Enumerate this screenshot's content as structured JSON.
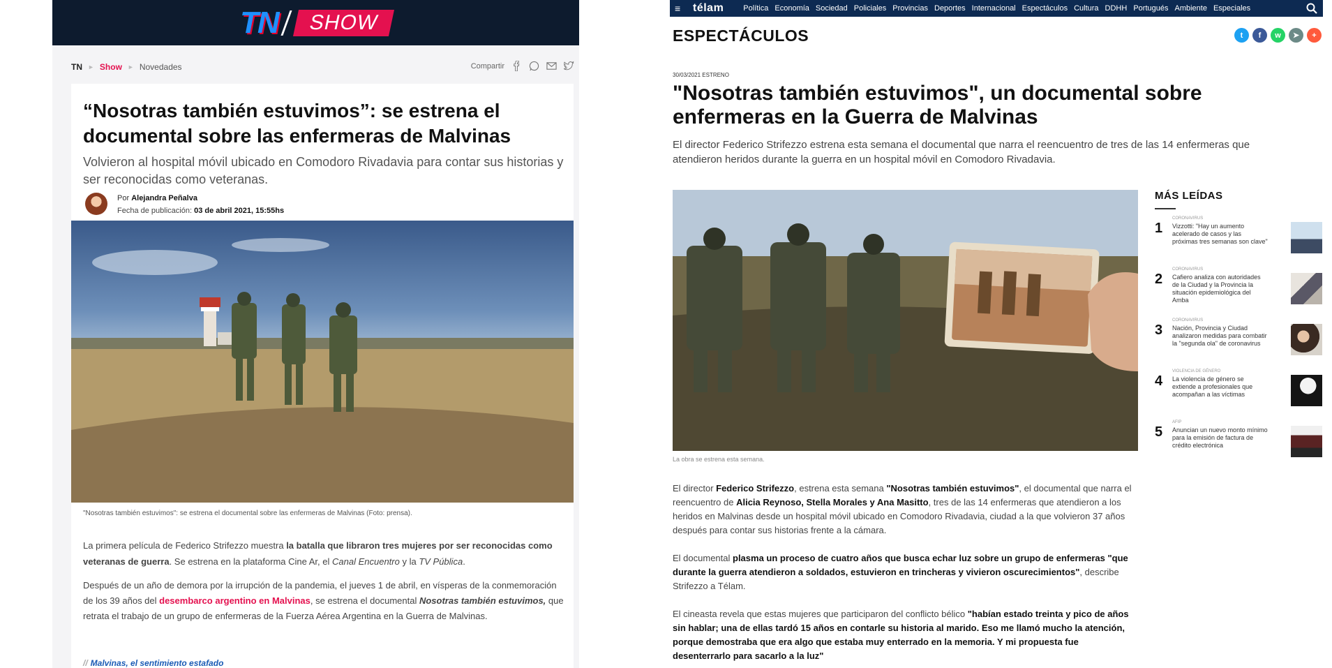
{
  "tn": {
    "logo": "TN",
    "show": "SHOW",
    "breadcrumb": {
      "home": "TN",
      "section": "Show",
      "current": "Novedades"
    },
    "share_label": "Compartir",
    "title": "“Nosotras también estuvimos”: se estrena el documental sobre las enfermeras de Malvinas",
    "subtitle": "Volvieron al hospital móvil ubicado en Comodoro Rivadavia para contar sus historias y ser reconocidas como veteranas.",
    "author_prefix": "Por",
    "author": "Alejandra Peñalva",
    "date_label": "Fecha de publicación:",
    "date": "03 de abril 2021, 15:55hs",
    "caption": "\"Nosotras también estuvimos\": se estrena el documental sobre las enfermeras de Malvinas (Foto: prensa).",
    "p1": {
      "a": "La primera película de Federico Strifezzo muestra ",
      "b": "la batalla que libraron tres mujeres por ser reconocidas como veteranas de guerra",
      "c": ". Se estrena en la plataforma Cine Ar, el ",
      "d": "Canal Encuentro",
      "e": " y la ",
      "f": "TV Pública",
      "g": "."
    },
    "p2": {
      "a": "Después de un año de demora por la irrupción de la pandemia, el jueves 1 de abril, en vísperas de la conmemoración de los 39 años del ",
      "link": "desembarco argentino en Malvinas",
      "b": ", se estrena el documental ",
      "c": "Nosotras también estuvimos,",
      "d": " que retrata el trabajo de un grupo de enfermeras de la Fuerza Aérea Argentina en la Guerra de Malvinas."
    },
    "related_bars": "//",
    "related": "Malvinas, el sentimiento estafado"
  },
  "telam": {
    "brand": "télam",
    "nav": [
      "Política",
      "Economía",
      "Sociedad",
      "Policiales",
      "Provincias",
      "Deportes",
      "Internacional",
      "Espectáculos",
      "Cultura",
      "DDHH",
      "Portugués",
      "Ambiente",
      "Especiales"
    ],
    "section": "ESPECTÁCULOS",
    "meta": "30/03/2021 ESTRENO",
    "title": "\"Nosotras también estuvimos\", un documental sobre enfermeras en la Guerra de Malvinas",
    "lead": "El director Federico Strifezzo estrena esta semana el documental que narra el reencuentro de tres de las 14 enfermeras que atendieron heridos durante la guerra en un hospital móvil en Comodoro Rivadavia.",
    "caption": "La obra se estrena esta semana.",
    "p1": {
      "a": "El director ",
      "b": "Federico Strifezzo",
      "c": ", estrena esta semana ",
      "d": "\"Nosotras también estuvimos\"",
      "e": ", el documental que narra el reencuentro de ",
      "f": "Alicia Reynoso, Stella Morales y Ana Masitto",
      "g": ", tres de las 14 enfermeras que atendieron a los heridos en Malvinas desde un hospital móvil ubicado en Comodoro Rivadavia, ciudad a la que volvieron 37 años después para contar sus historias frente a la cámara."
    },
    "p2": {
      "a": "El documental ",
      "b": "plasma un proceso de cuatro años que busca echar luz sobre un grupo de enfermeras \"que durante la guerra atendieron a soldados, estuvieron en trincheras y vivieron oscurecimientos\"",
      "c": ", describe Strifezzo a Télam."
    },
    "p3": {
      "a": "El cineasta revela que estas mujeres que participaron del conflicto bélico ",
      "b": "\"habían estado treinta y pico de años sin hablar; una de ellas tardó 15 años en contarle su historia al marido. Eso me llamó mucho la atención, porque demostraba que era algo que estaba muy enterrado en la memoria. Y mi propuesta fue desenterrarlo para sacarlo a la luz\""
    },
    "most_read_title": "MÁS LEÍDAS",
    "most_read": [
      {
        "num": "1",
        "cat": "CORONAVIRUS",
        "title": "Vizzotti: \"Hay un aumento acelerado de casos y las próximas tres semanas son clave\""
      },
      {
        "num": "2",
        "cat": "CORONAVIRUS",
        "title": "Cafiero analiza con autoridades de la Ciudad y la Provincia la situación epidemiológica del Amba"
      },
      {
        "num": "3",
        "cat": "CORONAVIRUS",
        "title": "Nación, Provincia y Ciudad analizaron medidas para combatir la \"segunda ola\" de coronavirus"
      },
      {
        "num": "4",
        "cat": "VIOLENCIA DE GÉNERO",
        "title": "La violencia de género se extiende a profesionales que acompañan a las víctimas"
      },
      {
        "num": "5",
        "cat": "AFIP",
        "title": "Anuncian un nuevo monto mínimo para la emisión de factura de crédito electrónica"
      }
    ],
    "social": [
      {
        "icon": "twitter-icon",
        "glyph": "t",
        "color": "#1da1f2"
      },
      {
        "icon": "facebook-icon",
        "glyph": "f",
        "color": "#3b5998"
      },
      {
        "icon": "whatsapp-icon",
        "glyph": "w",
        "color": "#25d366"
      },
      {
        "icon": "telegram-icon",
        "glyph": "➤",
        "color": "#6c8a87"
      },
      {
        "icon": "plus-icon",
        "glyph": "+",
        "color": "#ff5a3c"
      }
    ]
  }
}
